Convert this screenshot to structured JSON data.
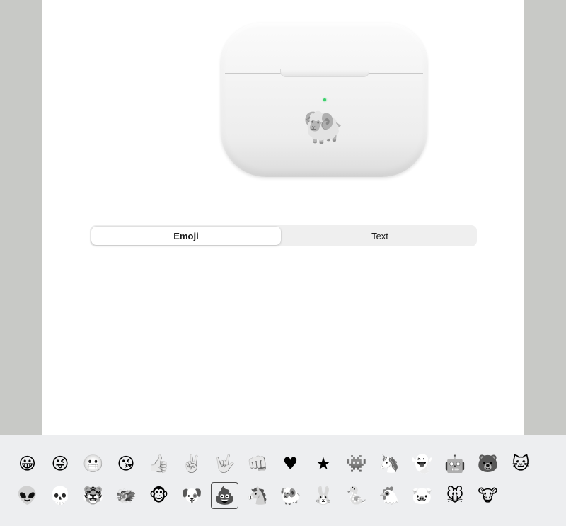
{
  "preview": {
    "engraving_emoji": "🐏",
    "led_color": "#3ad06a"
  },
  "segmented": {
    "options": [
      {
        "label": "Emoji",
        "selected": true
      },
      {
        "label": "Text",
        "selected": false
      }
    ]
  },
  "emoji_tray": {
    "selected_index": 22,
    "rows": [
      [
        "😀",
        "😜",
        "😬",
        "😘",
        "👍",
        "✌️",
        "🤟",
        "👊",
        "♥",
        "★",
        "👾",
        "🦄",
        "👻",
        "🤖",
        "🐻",
        "🐱"
      ],
      [
        "👽",
        "💀",
        "🐯",
        "🐲",
        "🐵",
        "🐶",
        "💩",
        "🐴",
        "🐏",
        "🐰",
        "🐍",
        "🐔",
        "🐷",
        "🐭",
        "🐮"
      ]
    ],
    "icon_names": [
      [
        "grinning-face-icon",
        "winking-tongue-face-icon",
        "grimacing-face-icon",
        "kissing-face-icon",
        "thumbs-up-icon",
        "victory-hand-icon",
        "love-you-gesture-icon",
        "fist-bump-icon",
        "heart-icon",
        "star-icon",
        "space-invader-icon",
        "unicorn-icon",
        "ghost-icon",
        "robot-icon",
        "bear-icon",
        "cat-icon"
      ],
      [
        "alien-icon",
        "skull-icon",
        "tiger-icon",
        "dragon-icon",
        "monkey-icon",
        "dog-icon",
        "poop-icon",
        "horse-icon",
        "ram-icon",
        "rabbit-icon",
        "snake-icon",
        "rooster-icon",
        "pig-icon",
        "mouse-icon",
        "cow-icon"
      ]
    ],
    "accent_color": "#2f5bd3"
  }
}
